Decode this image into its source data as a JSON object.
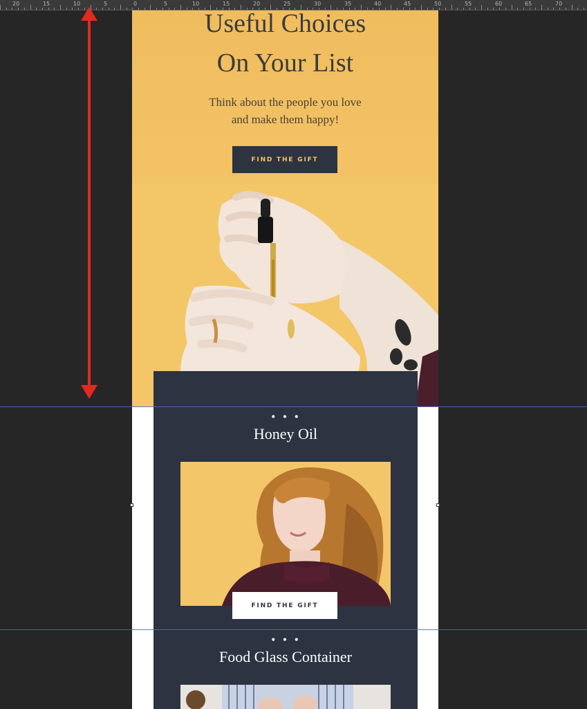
{
  "ruler": {
    "labels": [
      "20",
      "15",
      "10",
      "5",
      "0",
      "5",
      "10",
      "15",
      "20",
      "25",
      "30",
      "35",
      "40",
      "45",
      "50",
      "55",
      "60",
      "65",
      "70"
    ]
  },
  "hero": {
    "title_line1": "Useful Choices",
    "title_line2": "On Your List",
    "subtitle_line1": "Think about the people you love",
    "subtitle_line2": "and make them happy!",
    "button_label": "FIND THE GIFT"
  },
  "products": [
    {
      "dots": "• • •",
      "title": "Honey Oil",
      "button_label": "FIND THE GIFT"
    },
    {
      "dots": "• • •",
      "title": "Food Glass Container"
    }
  ],
  "colors": {
    "hero_bg": "#f3c668",
    "card_bg": "#2d3340",
    "guide": "#4b69c9",
    "arrow": "#e02a1f"
  }
}
